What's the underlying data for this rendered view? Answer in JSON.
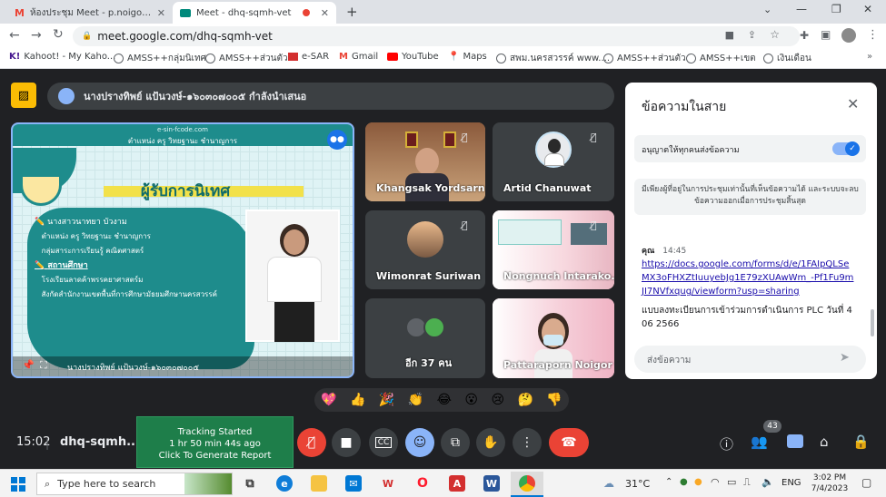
{
  "colors": {
    "chrome_bg": "#dee1e6",
    "meet_bg": "#202124",
    "tile_bg": "#3c4043",
    "leave_red": "#ea4335",
    "accent_blue": "#1a73e8",
    "slide_teal": "#1e8c8c",
    "tracking_green": "#1e7e4a"
  },
  "tabs": [
    {
      "title": "ห้องประชุม Meet - p.noigor@gma",
      "icon": "gmail-icon"
    },
    {
      "title": "Meet - dhq-sqmh-vet",
      "icon": "meet-icon",
      "active": true
    }
  ],
  "url": "meet.google.com/dhq-sqmh-vet",
  "bookmarks": [
    {
      "label": "Kahoot! - My Kaho..."
    },
    {
      "label": "AMSS++กลุ่มนิเทศ"
    },
    {
      "label": "AMSS++ส่วนตัว"
    },
    {
      "label": "e-SAR"
    },
    {
      "label": "Gmail"
    },
    {
      "label": "YouTube"
    },
    {
      "label": "Maps"
    },
    {
      "label": "สพม.นครสวรรค์ www...."
    },
    {
      "label": "AMSS++ส่วนตัว"
    },
    {
      "label": "AMSS++เขต"
    },
    {
      "label": "เงินเดือน"
    }
  ],
  "presenter_banner": "นางปรางทิพย์ แป้นวงษ์-๑๖๐๓๐๗๐๐๕ กำลังนำเสนอ",
  "slide": {
    "header_text": "ตำแหน่ง ครู วิทยฐานะ ชำนาญการ",
    "site": "e-sin-fcode.com",
    "title": "ผู้รับการนิเทศ",
    "lines": [
      "นางสาวนาทยา  บัวงาม",
      "ตำแหน่ง ครู  วิทยฐานะ ชำนาญการ",
      "กลุ่มสาระการเรียนรู้ คณิตศาสตร์",
      "สถานศึกษา",
      "โรงเรียนลาดค้าพรรคยาศาสตร์ม",
      "สังกัดสำนักงานเขตพื้นที่การศึกษามัธยมศึกษานครสวรรค์"
    ],
    "presenter_caption": "นางปรางทิพย์ แป้นวงษ์-๑๖๐๓๐๗๐๐๕"
  },
  "participants": [
    {
      "name": "Khangsak Yordsarn"
    },
    {
      "name": "Artid Chanuwat"
    },
    {
      "name": "Wimonrat Suriwan"
    },
    {
      "name": "Nongnuch Intarako..."
    },
    {
      "name": "อีก 37 คน"
    },
    {
      "name": "Pattaraporn Noigor"
    }
  ],
  "chat": {
    "title": "ข้อความในสาย",
    "toggle_label": "อนุญาตให้ทุกคนส่งข้อความ",
    "notice": "มีเพียงผู้ที่อยู่ในการประชุมเท่านั้นที่เห็นข้อความได้ และระบบจะลบข้อความออกเมื่อการประชุมสิ้นสุด",
    "sender": "คุณ",
    "time": "14:45",
    "link": "https://docs.google.com/forms/d/e/1FAIpQLSeMX3oFHXZtIuuyebJg1E79zXUAwWm_-Pf1Fu9mJI7NVfxqug/viewform?usp=sharing",
    "message": "แบบลงทะเบียนการเข้าร่วมการดำเนินการ PLC วันที่ 4 06 2566",
    "input_placeholder": "ส่งข้อความ"
  },
  "reactions": [
    "💖",
    "👍",
    "🎉",
    "👏",
    "😂",
    "😮",
    "😢",
    "🤔",
    "👎"
  ],
  "bottom_bar": {
    "clock": "15:02",
    "meeting_code": "dhq-sqmh...",
    "participant_count": "43"
  },
  "tracking": {
    "line1": "Tracking Started",
    "line2": "1 hr 50 min 44s ago",
    "line3": "Click To Generate Report"
  },
  "taskbar": {
    "search_placeholder": "Type here to search",
    "temperature": "31°C",
    "language": "ENG",
    "time": "3:02 PM",
    "date": "7/4/2023"
  }
}
